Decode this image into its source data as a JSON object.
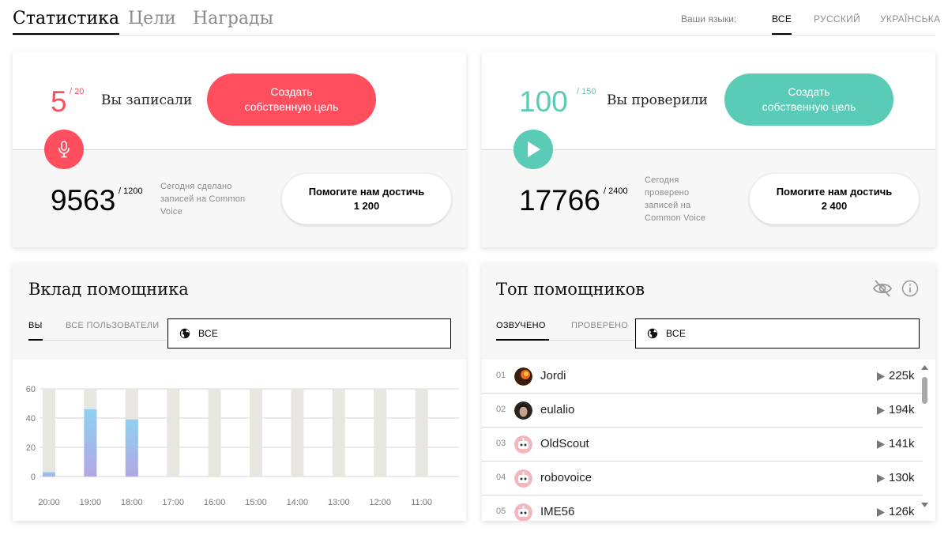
{
  "nav": {
    "tabs": [
      {
        "label": "Статистика",
        "active": true
      },
      {
        "label": "Цели",
        "active": false
      },
      {
        "label": "Награды",
        "active": false
      }
    ],
    "languages_label": "Ваши языки:",
    "languages": [
      {
        "label": "ВСЕ",
        "active": true
      },
      {
        "label": "РУССКИЙ",
        "active": false
      },
      {
        "label": "УКРАЇНСЬКА",
        "active": false
      }
    ]
  },
  "record_card": {
    "count": "5",
    "goal": "/ 20",
    "label": "Вы записали",
    "button_line1": "Создать",
    "button_line2": "собственную цель",
    "accent": "#ff4f5e",
    "today_total": "9563",
    "today_goal": "/ 1200",
    "today_note": [
      "Сегодня сделано",
      "записей на Common",
      "Voice"
    ],
    "help_line1": "Помогите нам достичь",
    "help_line2": "1 200",
    "icon": "microphone-icon"
  },
  "validate_card": {
    "count": "100",
    "goal": "/ 150",
    "label": "Вы проверили",
    "button_line1": "Создать",
    "button_line2": "собственную цель",
    "accent": "#59cbb7",
    "today_total": "17766",
    "today_goal": "/ 2400",
    "today_note": [
      "Сегодня",
      "проверено",
      "записей на",
      "Common Voice"
    ],
    "help_line1": "Помогите нам достичь",
    "help_line2": "2 400",
    "icon": "play-icon"
  },
  "contribution": {
    "title": "Вклад помощника",
    "tabs": [
      {
        "label": "ВЫ",
        "active": true
      },
      {
        "label": "ВСЕ ПОЛЬЗОВАТЕЛИ",
        "active": false
      }
    ],
    "select_value": "ВСЕ",
    "icon": "globe-icon"
  },
  "chart_data": {
    "type": "bar",
    "categories": [
      "20:00",
      "19:00",
      "18:00",
      "17:00",
      "16:00",
      "15:00",
      "14:00",
      "13:00",
      "12:00",
      "11:00"
    ],
    "values": [
      3,
      46,
      39,
      0,
      0,
      0,
      0,
      0,
      0,
      0
    ],
    "ylim": [
      0,
      60
    ],
    "yticks": [
      0,
      20,
      40,
      60
    ],
    "grid": true,
    "bar_color_top": "#8fd1f0",
    "bar_color_bottom": "#b1a8e3",
    "track_color": "#e8e6e1"
  },
  "leaderboard": {
    "title": "Топ помощников",
    "tabs": [
      {
        "label": "ОЗВУЧЕНО",
        "active": true
      },
      {
        "label": "ПРОВЕРЕНО",
        "active": false
      }
    ],
    "select_value": "ВСЕ",
    "rows": [
      {
        "rank": "01",
        "name": "Jordi",
        "count": "225k",
        "avatar": "photo-dark"
      },
      {
        "rank": "02",
        "name": "eulalio",
        "count": "194k",
        "avatar": "photo-face"
      },
      {
        "rank": "03",
        "name": "OldScout",
        "count": "141k",
        "avatar": "robot"
      },
      {
        "rank": "04",
        "name": "robovoice",
        "count": "130k",
        "avatar": "robot"
      },
      {
        "rank": "05",
        "name": "IME56",
        "count": "126k",
        "avatar": "robot"
      }
    ]
  }
}
